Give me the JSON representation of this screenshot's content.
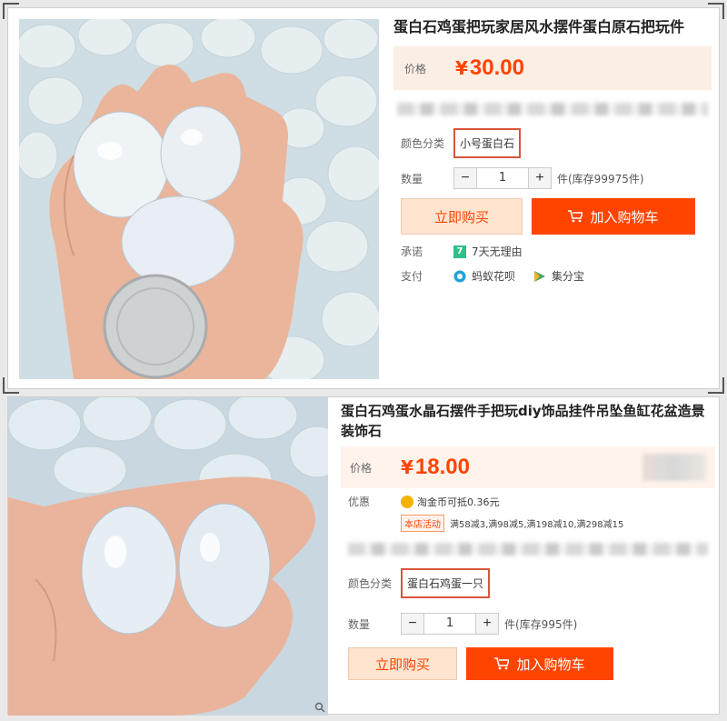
{
  "listing1": {
    "title": "蛋白石鸡蛋把玩家居风水摆件蛋白原石把玩件",
    "price_label": "价格",
    "currency": "¥",
    "price": "30.00",
    "color_label": "颜色分类",
    "color_option": "小号蛋白石",
    "qty_label": "数量",
    "qty_minus": "−",
    "qty_value": "1",
    "qty_plus": "+",
    "stock": "件(库存99975件)",
    "buy_now": "立即购买",
    "add_cart": "加入购物车",
    "promise_label": "承诺",
    "promise_badge": "7",
    "promise_text": "7天无理由",
    "pay_label": "支付",
    "pay_option1": "蚂蚁花呗",
    "pay_option2": "集分宝"
  },
  "listing2": {
    "title": "蛋白石鸡蛋水晶石摆件手把玩diy饰品挂件吊坠鱼缸花盆造景装饰石",
    "price_label": "价格",
    "currency": "¥",
    "price": "18.00",
    "discount_label": "优惠",
    "coin_text": "淘金币可抵0.36元",
    "promo_tag": "本店活动",
    "promo_text": "满58减3,满98减5,满198减10,满298减15",
    "color_label": "颜色分类",
    "color_option": "蛋白石鸡蛋一只",
    "qty_label": "数量",
    "qty_minus": "−",
    "qty_value": "1",
    "qty_plus": "+",
    "stock": "件(库存995件)",
    "buy_now": "立即购买",
    "add_cart": "加入购物车"
  },
  "colors": {
    "accent": "#ff4400",
    "price_bg": "#fbeee4",
    "chip_border": "#d9553c",
    "promise_green": "#2fbf88"
  }
}
